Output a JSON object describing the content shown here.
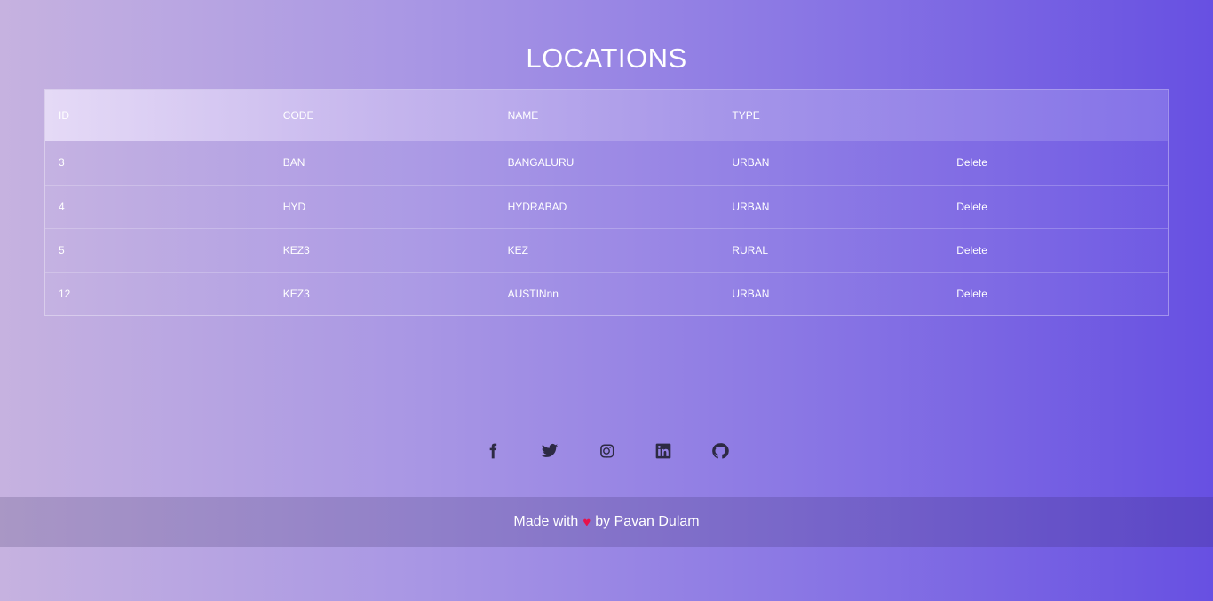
{
  "page": {
    "title": "LOCATIONS"
  },
  "table": {
    "columns": [
      "ID",
      "CODE",
      "NAME",
      "TYPE",
      ""
    ],
    "rows": [
      {
        "id": "3",
        "code": "BAN",
        "name": "BANGALURU",
        "type": "URBAN",
        "action": "Delete"
      },
      {
        "id": "4",
        "code": "HYD",
        "name": "HYDRABAD",
        "type": "URBAN",
        "action": "Delete"
      },
      {
        "id": "5",
        "code": "KEZ3",
        "name": "KEZ",
        "type": "RURAL",
        "action": "Delete"
      },
      {
        "id": "12",
        "code": "KEZ3",
        "name": "AUSTINnn",
        "type": "URBAN",
        "action": "Delete"
      }
    ]
  },
  "social": {
    "icons": [
      "facebook-icon",
      "twitter-icon",
      "instagram-icon",
      "linkedin-icon",
      "github-icon"
    ]
  },
  "footer": {
    "prefix": "Made with",
    "heart": "♥",
    "suffix": "by Pavan Dulam"
  },
  "colors": {
    "gradient_start": "#c6b2e0",
    "gradient_end": "#6750e2",
    "heart": "#e8124b",
    "icon": "#2d2a44"
  }
}
